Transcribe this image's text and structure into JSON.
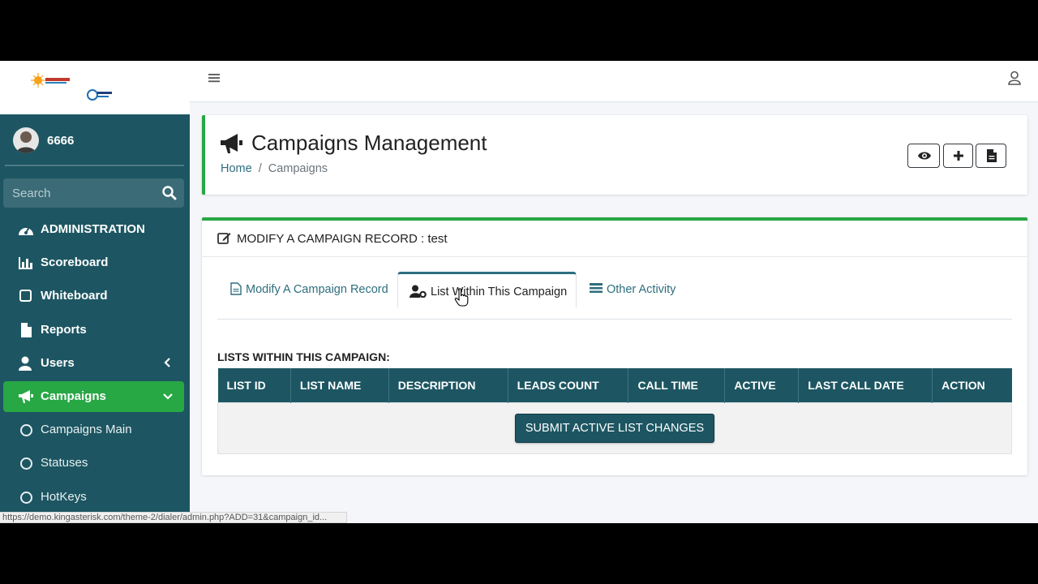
{
  "sidebar": {
    "logo_icon": "kingasterisk-dialer-logo",
    "user": {
      "name": "6666"
    },
    "search": {
      "placeholder": "Search"
    },
    "nav": [
      {
        "label": "ADMINISTRATION",
        "icon": "tachometer-icon"
      },
      {
        "label": "Scoreboard",
        "icon": "bar-chart-icon"
      },
      {
        "label": "Whiteboard",
        "icon": "square-icon"
      },
      {
        "label": "Reports",
        "icon": "file-icon"
      },
      {
        "label": "Users",
        "icon": "user-icon"
      },
      {
        "label": "Campaigns",
        "icon": "bullhorn-icon",
        "active": true
      },
      {
        "label": "Campaigns Main",
        "icon": "circle-icon"
      },
      {
        "label": "Statuses",
        "icon": "circle-icon"
      },
      {
        "label": "HotKeys",
        "icon": "circle-icon"
      }
    ]
  },
  "header": {
    "title": "Campaigns Management",
    "breadcrumb": {
      "home": "Home",
      "sep": "/",
      "current": "Campaigns"
    },
    "buttons": [
      "eye-icon",
      "plus-icon",
      "file-icon"
    ]
  },
  "card": {
    "title": "MODIFY A CAMPAIGN RECORD : test",
    "tabs": [
      {
        "label": "Modify A Campaign Record"
      },
      {
        "label": "List Within This Campaign",
        "active": true
      },
      {
        "label": "Other Activity"
      }
    ],
    "lists_title": "LISTS WITHIN THIS CAMPAIGN:",
    "table_headers": [
      "LIST ID",
      "LIST NAME",
      "DESCRIPTION",
      "LEADS COUNT",
      "CALL TIME",
      "ACTIVE",
      "LAST CALL DATE",
      "ACTION"
    ],
    "submit_label": "SUBMIT ACTIVE LIST CHANGES"
  },
  "statusbar": {
    "url": "https://demo.kingasterisk.com/theme-2/dialer/admin.php?ADD=31&campaign_id..."
  },
  "colors": {
    "sidebar": "#1d5662",
    "accent": "#28a745",
    "link": "#2d6e7e"
  }
}
